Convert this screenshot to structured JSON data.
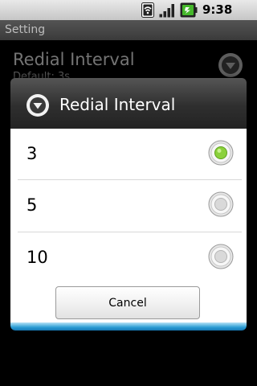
{
  "status_bar": {
    "time": "9:38 AM",
    "icons": [
      "wifi-icon",
      "signal-icon",
      "battery-icon"
    ]
  },
  "title_bar": {
    "title": "Setting"
  },
  "background_preference": {
    "title": "Redial Interval",
    "summary": "Default:  3s"
  },
  "dialog": {
    "title": "Redial Interval",
    "options": [
      {
        "label": "3",
        "selected": true
      },
      {
        "label": "5",
        "selected": false
      },
      {
        "label": "10",
        "selected": false
      }
    ],
    "cancel_label": "Cancel"
  },
  "colors": {
    "radio_selected": "#8bd13c",
    "dialog_accent": "#2a9cd4"
  }
}
